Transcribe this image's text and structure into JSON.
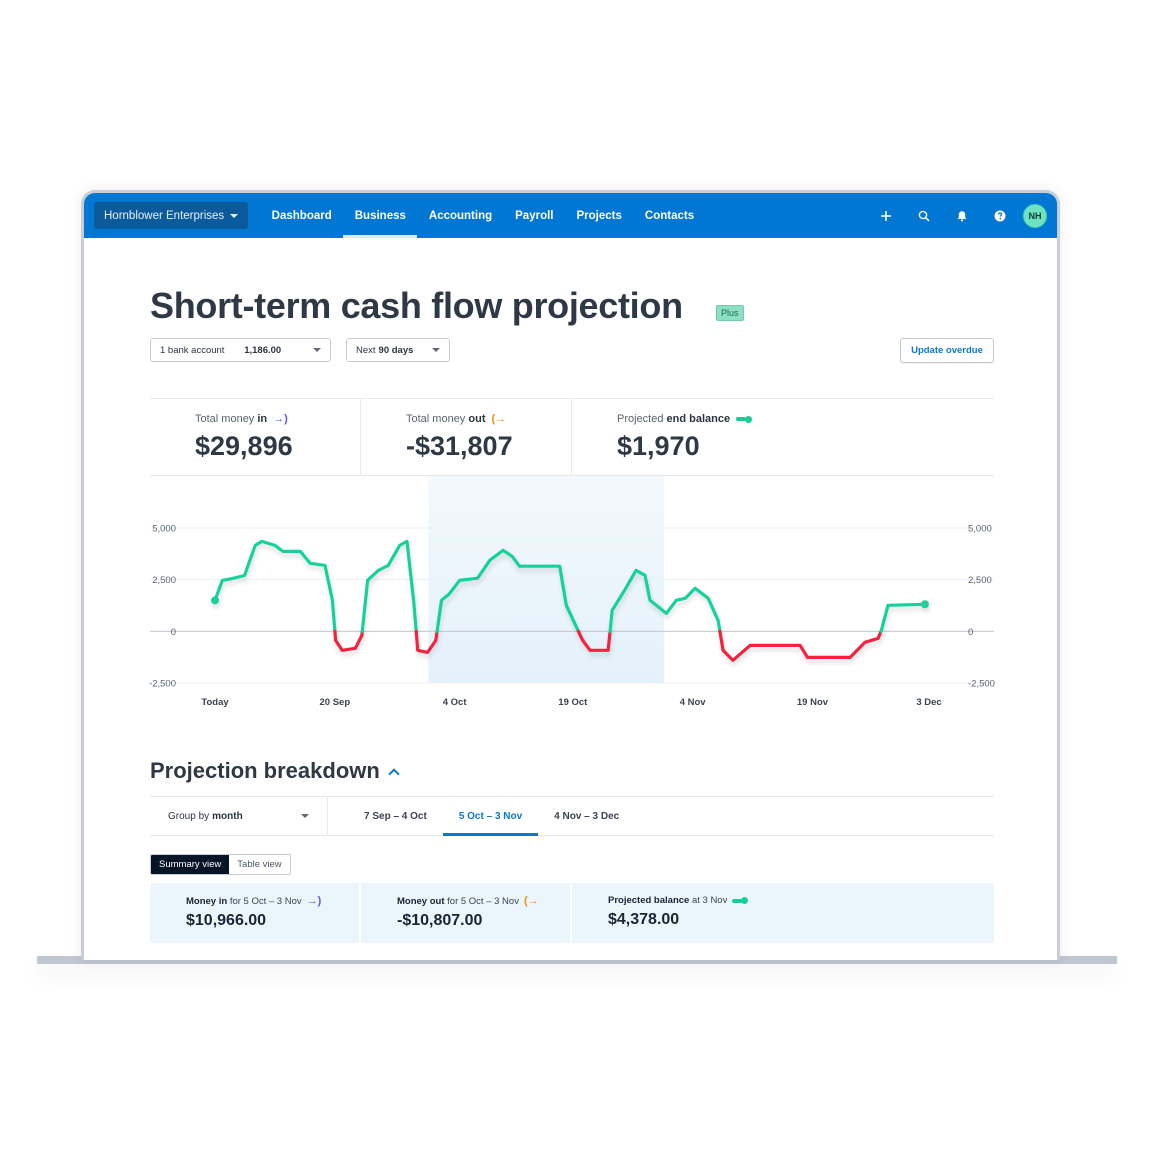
{
  "nav": {
    "org_name": "Hornblower Enterprises",
    "items": [
      {
        "label": "Dashboard",
        "active": false
      },
      {
        "label": "Business",
        "active": true
      },
      {
        "label": "Accounting",
        "active": false
      },
      {
        "label": "Payroll",
        "active": false
      },
      {
        "label": "Projects",
        "active": false
      },
      {
        "label": "Contacts",
        "active": false
      }
    ],
    "icons": [
      "plus-icon",
      "search-icon",
      "bell-icon",
      "help-icon"
    ],
    "avatar_initials": "NH"
  },
  "page": {
    "title": "Short-term cash flow projection",
    "badge": "Plus",
    "bank_select": {
      "label": "1 bank account",
      "amount": "1,186.00"
    },
    "range_select": {
      "prefix": "Next",
      "value": "90 days"
    },
    "update_button": "Update overdue"
  },
  "stats": [
    {
      "label_prefix": "Total money",
      "label_bold": "in",
      "value": "$29,896",
      "icon": "money-in-icon"
    },
    {
      "label_prefix": "Total money",
      "label_bold": "out",
      "value": "-$31,807",
      "icon": "money-out-icon"
    },
    {
      "label_prefix": "Projected",
      "label_bold": "end balance",
      "value": "$1,970",
      "icon": "balance-icon"
    }
  ],
  "colors": {
    "brand": "#0176d3",
    "positive_line": "#13d29a",
    "negative_line": "#f5203e",
    "money_in": "#5f55e6",
    "money_out": "#f08a13",
    "highlight_band": "#e6f3fb"
  },
  "chart_data": {
    "type": "line",
    "title": "",
    "xlabel": "",
    "ylabel": "",
    "ylim": [
      -2500,
      5000
    ],
    "y_ticks": [
      5000,
      2500,
      0,
      -2500
    ],
    "y_tick_labels": [
      "5,000",
      "2,500",
      "0",
      "-2,500"
    ],
    "x_range_days": [
      0,
      87
    ],
    "x_ticks": [
      {
        "day": 0,
        "label": "Today"
      },
      {
        "day": 14.6,
        "label": "20 Sep"
      },
      {
        "day": 29.2,
        "label": "4 Oct"
      },
      {
        "day": 43.6,
        "label": "19 Oct"
      },
      {
        "day": 58.2,
        "label": "4 Nov"
      },
      {
        "day": 72.8,
        "label": "19 Nov"
      },
      {
        "day": 87,
        "label": "3 Dec"
      }
    ],
    "highlight_range_days": [
      26.0,
      54.7
    ],
    "highlight_label": "5 Oct – 3 Nov",
    "grid": true,
    "series": [
      {
        "name": "Projected balance",
        "positive_color": "#13d29a",
        "negative_color": "#f5203e",
        "points": [
          [
            0,
            1500
          ],
          [
            0.9,
            2470
          ],
          [
            2.1,
            2550
          ],
          [
            3.6,
            2700
          ],
          [
            4.9,
            4160
          ],
          [
            5.7,
            4350
          ],
          [
            7.3,
            4160
          ],
          [
            8.3,
            3870
          ],
          [
            10.4,
            3870
          ],
          [
            11.6,
            3290
          ],
          [
            13.4,
            3190
          ],
          [
            14.3,
            1500
          ],
          [
            14.7,
            -440
          ],
          [
            15.5,
            -920
          ],
          [
            17.1,
            -820
          ],
          [
            17.9,
            -190
          ],
          [
            18.6,
            2470
          ],
          [
            19.9,
            2950
          ],
          [
            21.1,
            3190
          ],
          [
            22.5,
            4160
          ],
          [
            23.4,
            4350
          ],
          [
            24.2,
            1500
          ],
          [
            24.7,
            -920
          ],
          [
            25.9,
            -1020
          ],
          [
            26.9,
            -440
          ],
          [
            27.6,
            1500
          ],
          [
            28.5,
            1790
          ],
          [
            29.8,
            2470
          ],
          [
            32.0,
            2570
          ],
          [
            33.5,
            3440
          ],
          [
            35.1,
            3920
          ],
          [
            36.2,
            3630
          ],
          [
            37.1,
            3150
          ],
          [
            42.0,
            3150
          ],
          [
            42.8,
            1260
          ],
          [
            44.8,
            -440
          ],
          [
            45.7,
            -920
          ],
          [
            47.9,
            -920
          ],
          [
            48.4,
            1020
          ],
          [
            49.9,
            1980
          ],
          [
            51.3,
            2950
          ],
          [
            52.4,
            2710
          ],
          [
            53.0,
            1500
          ],
          [
            55.0,
            870
          ],
          [
            56.2,
            1500
          ],
          [
            57.3,
            1600
          ],
          [
            58.5,
            2080
          ],
          [
            60.1,
            1600
          ],
          [
            61.3,
            530
          ],
          [
            61.9,
            -920
          ],
          [
            63.1,
            -1400
          ],
          [
            65.2,
            -680
          ],
          [
            71.3,
            -680
          ],
          [
            72.2,
            -1260
          ],
          [
            77.4,
            -1260
          ],
          [
            79.2,
            -530
          ],
          [
            80.8,
            -340
          ],
          [
            81.2,
            50
          ],
          [
            82.0,
            1260
          ],
          [
            86.5,
            1310
          ]
        ]
      }
    ]
  },
  "breakdown": {
    "title": "Projection breakdown",
    "group_by_prefix": "Group by",
    "group_by_value": "month",
    "periods": [
      {
        "label": "7 Sep – 4 Oct",
        "active": false
      },
      {
        "label": "5 Oct – 3 Nov",
        "active": true
      },
      {
        "label": "4 Nov – 3 Dec",
        "active": false
      }
    ],
    "views": [
      {
        "label": "Summary view",
        "active": true
      },
      {
        "label": "Table view",
        "active": false
      }
    ],
    "cards": [
      {
        "label_bold": "Money in",
        "label_rest": "for 5 Oct – 3 Nov",
        "value": "$10,966.00",
        "icon": "money-in-icon"
      },
      {
        "label_bold": "Money out",
        "label_rest": "for 5 Oct – 3 Nov",
        "value": "-$10,807.00",
        "icon": "money-out-icon"
      },
      {
        "label_bold": "Projected balance",
        "label_rest": "at 3 Nov",
        "value": "$4,378.00",
        "icon": "balance-icon"
      }
    ]
  }
}
